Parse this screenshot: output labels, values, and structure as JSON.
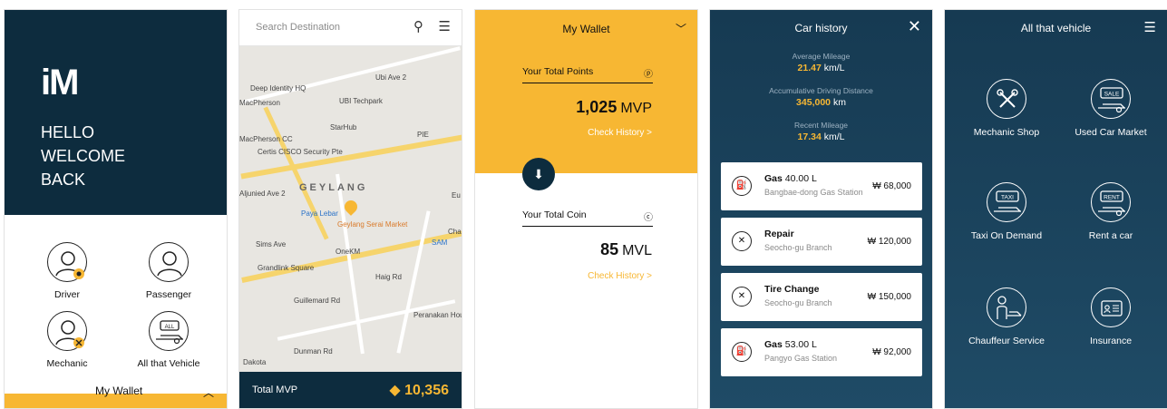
{
  "screen1": {
    "logo": "iM",
    "welcome": [
      "HELLO",
      "WELCOME",
      "BACK"
    ],
    "roles": [
      "Driver",
      "Passenger",
      "Mechanic",
      "All that Vehicle"
    ],
    "wallet_label": "My Wallet",
    "chevron": "^"
  },
  "screen2": {
    "search_placeholder": "Search Destination",
    "map_labels": [
      "Ubi Ave 2",
      "Deep Identity HQ",
      "MacPherson",
      "UBI Techpark",
      "StarHub",
      "PIE",
      "MacPherson CC",
      "Certis CISCO Security Pte",
      "GEYLANG",
      "Paya Lebar",
      "Geylang Serai Market",
      "Sims Ave",
      "OneKM",
      "SAM",
      "Grandlink Square",
      "Guillemard Rd",
      "Haig Rd",
      "Peranakan Hou",
      "Dunman Rd",
      "Dakota",
      "Aljunied Ave 2",
      "Char",
      "Eu"
    ],
    "total_label": "Total MVP",
    "total_value": "10,356"
  },
  "screen3": {
    "title": "My Wallet",
    "points_label": "Your Total Points",
    "points_value": "1,025",
    "points_unit": "MVP",
    "check_history": "Check History  >",
    "coin_label": "Your Total Coin",
    "coin_value": "85",
    "coin_unit": "MVL"
  },
  "screen4": {
    "title": "Car history",
    "stats": [
      {
        "label": "Average Mileage",
        "value": "21.47",
        "unit": "km/L"
      },
      {
        "label": "Accumulative Driving Distance",
        "value": "345,000",
        "unit": "km"
      },
      {
        "label": "Recent Mileage",
        "value": "17.34",
        "unit": "km/L"
      }
    ],
    "records": [
      {
        "title": "Gas",
        "amount": "40.00 L",
        "location": "Bangbae-dong Gas Station",
        "price": "₩ 68,000"
      },
      {
        "title": "Repair",
        "amount": "",
        "location": "Seocho-gu Branch",
        "price": "₩ 120,000"
      },
      {
        "title": "Tire Change",
        "amount": "",
        "location": "Seocho-gu Branch",
        "price": "₩ 150,000"
      },
      {
        "title": "Gas",
        "amount": "53.00 L",
        "location": "Pangyo Gas Station",
        "price": "₩ 92,000"
      }
    ]
  },
  "screen5": {
    "title": "All that vehicle",
    "items": [
      "Mechanic Shop",
      "Used Car Market",
      "Taxi On Demand",
      "Rent a car",
      "Chauffeur Service",
      "Insurance"
    ],
    "badges": [
      "SALE",
      "TAXI",
      "RENT",
      "ALL"
    ]
  }
}
